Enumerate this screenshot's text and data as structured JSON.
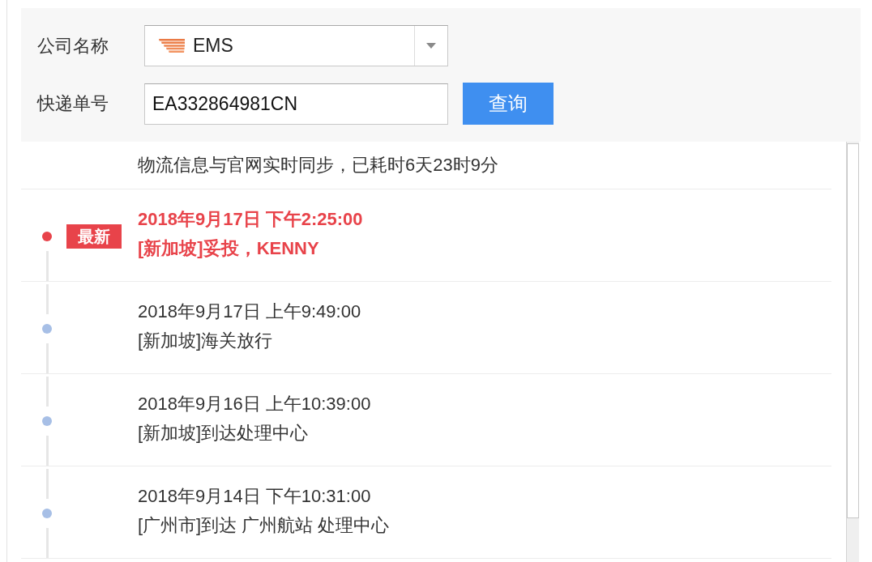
{
  "form": {
    "company": {
      "label": "公司名称",
      "value": "EMS"
    },
    "tracking_number": {
      "label": "快递单号",
      "value": "EA332864981CN"
    },
    "search_button": "查询"
  },
  "tracking": {
    "sync_note": "物流信息与官网实时同步，已耗时6天23时9分",
    "events": [
      {
        "time": "2018年9月17日 下午2:25:00",
        "description": "[新加坡]妥投，KENNY",
        "latest": true,
        "badge": "最新"
      },
      {
        "time": "2018年9月17日 上午9:49:00",
        "description": "[新加坡]海关放行",
        "latest": false
      },
      {
        "time": "2018年9月16日 上午10:39:00",
        "description": "[新加坡]到达处理中心",
        "latest": false
      },
      {
        "time": "2018年9月14日 下午10:31:00",
        "description": "[广州市]到达 广州航站 处理中心",
        "latest": false
      }
    ]
  }
}
